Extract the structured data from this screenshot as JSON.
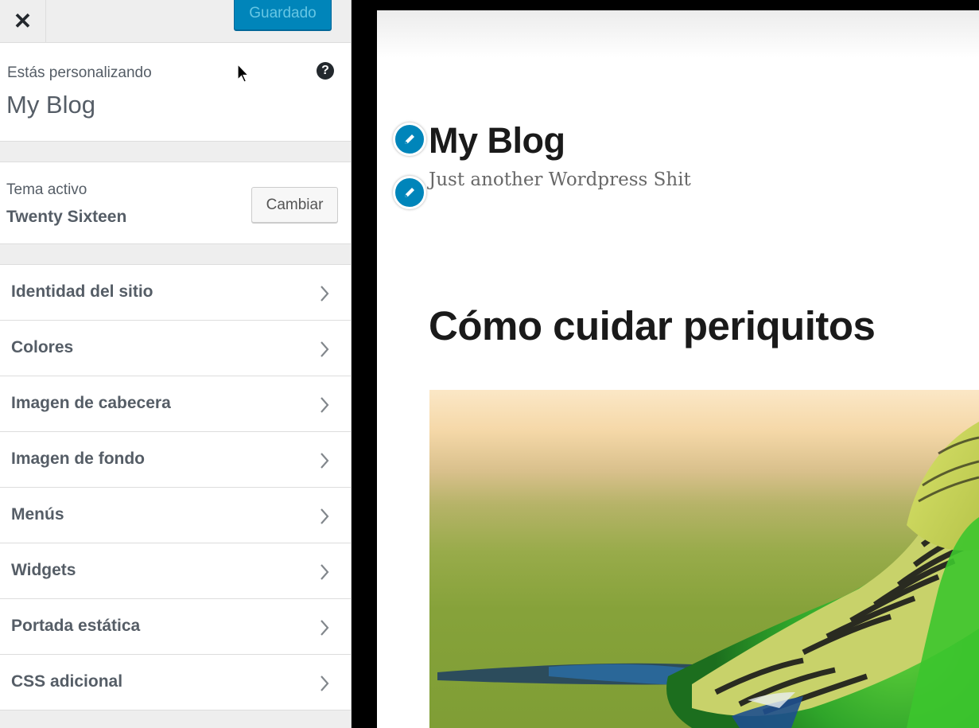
{
  "header": {
    "close_symbol": "✕",
    "save_label": "Guardado"
  },
  "info": {
    "label": "Estás personalizando",
    "site_name": "My Blog",
    "help_symbol": "?"
  },
  "theme": {
    "label": "Tema activo",
    "name": "Twenty Sixteen",
    "change_label": "Cambiar"
  },
  "menu": {
    "items": [
      {
        "label": "Identidad del sitio"
      },
      {
        "label": "Colores"
      },
      {
        "label": "Imagen de cabecera"
      },
      {
        "label": "Imagen de fondo"
      },
      {
        "label": "Menús"
      },
      {
        "label": "Widgets"
      },
      {
        "label": "Portada estática"
      },
      {
        "label": "CSS adicional"
      }
    ]
  },
  "preview": {
    "site_title": "My Blog",
    "tagline": "Just another Wordpress Shit",
    "post_title": "Cómo cuidar periquitos"
  },
  "colors": {
    "accent": "#0085ba",
    "sidebar_text": "#555d66"
  }
}
